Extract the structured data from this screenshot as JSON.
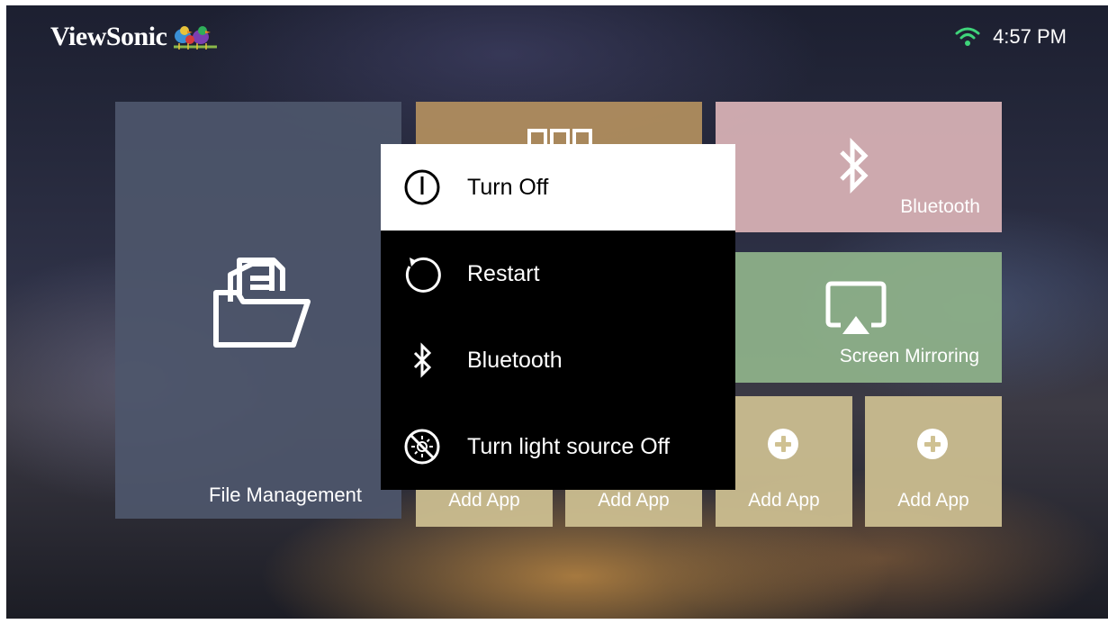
{
  "brand": {
    "name": "ViewSonic",
    "logo_icon": "birds-logo-icon"
  },
  "status_bar": {
    "wifi_icon": "wifi-icon",
    "time": "4:57 PM"
  },
  "tiles": {
    "file_management": {
      "label": "File Management",
      "icon": "folder-documents-icon",
      "color": "#4e566c"
    },
    "apps": {
      "label": "",
      "icon": "apps-grid-icon",
      "color": "#b38f5f"
    },
    "bluetooth": {
      "label": "Bluetooth",
      "icon": "bluetooth-icon",
      "color": "#d6b0b4"
    },
    "screen_mirroring": {
      "label": "Screen Mirroring",
      "icon": "screen-mirroring-icon",
      "color": "#8db089"
    },
    "add_apps": [
      {
        "label": "Add App",
        "icon": "plus-circle-icon"
      },
      {
        "label": "Add App",
        "icon": "plus-circle-icon"
      },
      {
        "label": "Add App",
        "icon": "plus-circle-icon"
      },
      {
        "label": "Add App",
        "icon": "plus-circle-icon"
      }
    ]
  },
  "power_menu": {
    "items": [
      {
        "label": "Turn Off",
        "icon": "power-icon",
        "selected": true
      },
      {
        "label": "Restart",
        "icon": "restart-icon",
        "selected": false
      },
      {
        "label": "Bluetooth",
        "icon": "bluetooth-icon",
        "selected": false
      },
      {
        "label": "Turn light source Off",
        "icon": "light-off-icon",
        "selected": false
      }
    ]
  }
}
